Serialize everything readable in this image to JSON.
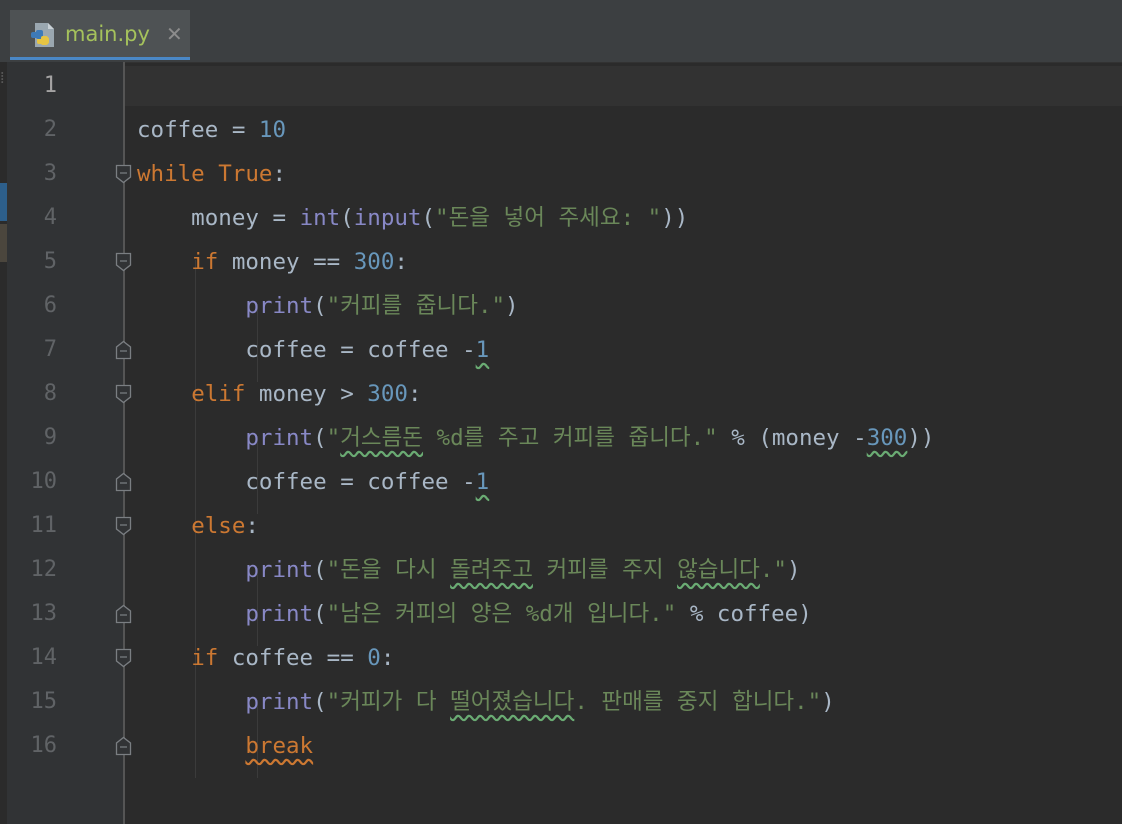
{
  "tab": {
    "filename": "main.py",
    "close_symbol": "✕",
    "icon": "python-file-icon"
  },
  "editor": {
    "line_numbers": [
      "1",
      "2",
      "3",
      "4",
      "5",
      "6",
      "7",
      "8",
      "9",
      "10",
      "11",
      "12",
      "13",
      "14",
      "15",
      "16"
    ],
    "lines": [
      {
        "segments": []
      },
      {
        "segments": [
          {
            "t": "coffee = ",
            "c": "plain"
          },
          {
            "t": "10",
            "c": "num"
          }
        ]
      },
      {
        "segments": [
          {
            "t": "while ",
            "c": "kw"
          },
          {
            "t": "True",
            "c": "kw"
          },
          {
            "t": ":",
            "c": "plain"
          }
        ]
      },
      {
        "segments": [
          {
            "t": "    money = ",
            "c": "plain"
          },
          {
            "t": "int",
            "c": "bi"
          },
          {
            "t": "(",
            "c": "plain"
          },
          {
            "t": "input",
            "c": "bi"
          },
          {
            "t": "(",
            "c": "plain"
          },
          {
            "t": "\"돈을 넣어 주세요: \"",
            "c": "str"
          },
          {
            "t": "))",
            "c": "plain"
          }
        ]
      },
      {
        "segments": [
          {
            "t": "    ",
            "c": "plain"
          },
          {
            "t": "if ",
            "c": "kw"
          },
          {
            "t": "money == ",
            "c": "plain"
          },
          {
            "t": "300",
            "c": "num"
          },
          {
            "t": ":",
            "c": "plain"
          }
        ]
      },
      {
        "segments": [
          {
            "t": "        ",
            "c": "plain"
          },
          {
            "t": "print",
            "c": "bi"
          },
          {
            "t": "(",
            "c": "plain"
          },
          {
            "t": "\"커피를 줍니다.\"",
            "c": "str"
          },
          {
            "t": ")",
            "c": "plain"
          }
        ]
      },
      {
        "segments": [
          {
            "t": "        coffee = coffee -",
            "c": "plain"
          },
          {
            "t": "1",
            "c": "num wavy"
          }
        ]
      },
      {
        "segments": [
          {
            "t": "    ",
            "c": "plain"
          },
          {
            "t": "elif ",
            "c": "kw"
          },
          {
            "t": "money > ",
            "c": "plain"
          },
          {
            "t": "300",
            "c": "num"
          },
          {
            "t": ":",
            "c": "plain"
          }
        ]
      },
      {
        "segments": [
          {
            "t": "        ",
            "c": "plain"
          },
          {
            "t": "print",
            "c": "bi"
          },
          {
            "t": "(",
            "c": "plain"
          },
          {
            "t": "\"",
            "c": "str"
          },
          {
            "t": "거스름돈",
            "c": "str wavy"
          },
          {
            "t": " %d를 주고 커피를 줍니다.\"",
            "c": "str"
          },
          {
            "t": " % (money -",
            "c": "plain"
          },
          {
            "t": "300",
            "c": "num wavy"
          },
          {
            "t": "))",
            "c": "plain"
          }
        ]
      },
      {
        "segments": [
          {
            "t": "        coffee = coffee -",
            "c": "plain"
          },
          {
            "t": "1",
            "c": "num wavy"
          }
        ]
      },
      {
        "segments": [
          {
            "t": "    ",
            "c": "plain"
          },
          {
            "t": "else",
            "c": "kw"
          },
          {
            "t": ":",
            "c": "plain"
          }
        ]
      },
      {
        "segments": [
          {
            "t": "        ",
            "c": "plain"
          },
          {
            "t": "print",
            "c": "bi"
          },
          {
            "t": "(",
            "c": "plain"
          },
          {
            "t": "\"돈을 다시 ",
            "c": "str"
          },
          {
            "t": "돌려주고",
            "c": "str wavy"
          },
          {
            "t": " 커피를 주지 ",
            "c": "str"
          },
          {
            "t": "않습니다",
            "c": "str wavy"
          },
          {
            "t": ".\"",
            "c": "str"
          },
          {
            "t": ")",
            "c": "plain"
          }
        ]
      },
      {
        "segments": [
          {
            "t": "        ",
            "c": "plain"
          },
          {
            "t": "print",
            "c": "bi"
          },
          {
            "t": "(",
            "c": "plain"
          },
          {
            "t": "\"남은 커피의 양은 %d개 입니다.\"",
            "c": "str"
          },
          {
            "t": " % coffee)",
            "c": "plain"
          }
        ]
      },
      {
        "segments": [
          {
            "t": "    ",
            "c": "plain"
          },
          {
            "t": "if ",
            "c": "kw"
          },
          {
            "t": "coffee == ",
            "c": "plain"
          },
          {
            "t": "0",
            "c": "num"
          },
          {
            "t": ":",
            "c": "plain"
          }
        ]
      },
      {
        "segments": [
          {
            "t": "        ",
            "c": "plain"
          },
          {
            "t": "print",
            "c": "bi"
          },
          {
            "t": "(",
            "c": "plain"
          },
          {
            "t": "\"커피가 다 ",
            "c": "str"
          },
          {
            "t": "떨어졌습니다",
            "c": "str wavy"
          },
          {
            "t": ". 판매를 중지 합니다.\"",
            "c": "str"
          },
          {
            "t": ")",
            "c": "plain"
          }
        ]
      },
      {
        "segments": [
          {
            "t": "        ",
            "c": "plain"
          },
          {
            "t": "break",
            "c": "kw wavy-o"
          }
        ]
      }
    ],
    "current_line": "1",
    "fold_markers": [
      {
        "line": 3,
        "kind": "open"
      },
      {
        "line": 5,
        "kind": "open"
      },
      {
        "line": 7,
        "kind": "close"
      },
      {
        "line": 8,
        "kind": "open"
      },
      {
        "line": 10,
        "kind": "close"
      },
      {
        "line": 11,
        "kind": "open"
      },
      {
        "line": 13,
        "kind": "close"
      },
      {
        "line": 14,
        "kind": "open"
      },
      {
        "line": 16,
        "kind": "close"
      }
    ]
  },
  "colors": {
    "background": "#2b2b2b",
    "gutter": "#313335",
    "keyword": "#cc7832",
    "number": "#6897bb",
    "string": "#6a8759",
    "builtin": "#8888c6",
    "plain": "#a9b7c6",
    "tab_text": "#a5c25c"
  }
}
